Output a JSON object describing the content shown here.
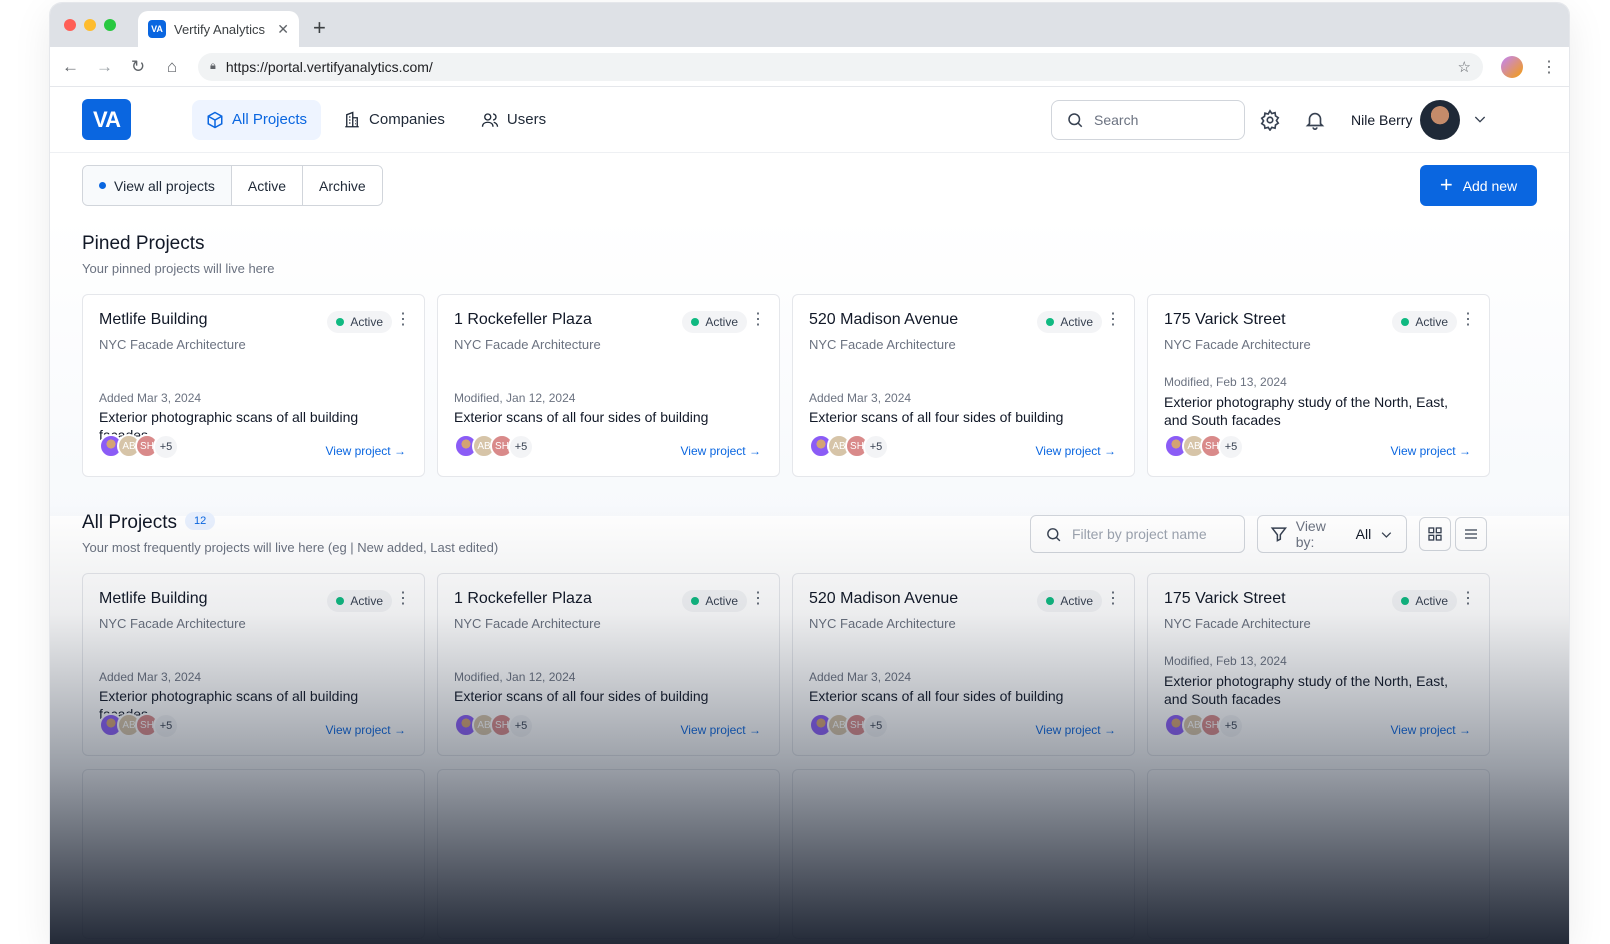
{
  "browser": {
    "tab_title": "Vertify Analytics",
    "tab_logo_text": "VA",
    "url": "https://portal.vertifyanalytics.com/"
  },
  "header": {
    "logo_text": "VA",
    "nav": [
      {
        "label": "All Projects",
        "icon": "cube-icon",
        "active": true
      },
      {
        "label": "Companies",
        "icon": "building-icon",
        "active": false
      },
      {
        "label": "Users",
        "icon": "users-icon",
        "active": false
      }
    ],
    "search_placeholder": "Search",
    "user_name": "Nile Berry"
  },
  "filters": {
    "segments": [
      "View all projects",
      "Active",
      "Archive"
    ],
    "selected": "View all projects",
    "add_button": "Add new"
  },
  "pinned": {
    "title": "Pined Projects",
    "subtitle": "Your pinned projects will live here",
    "cards": [
      {
        "title": "Metlife Building",
        "company": "NYC Facade Architecture",
        "status": "Active",
        "meta": "Added Mar 3, 2024",
        "desc": "Exterior photographic scans of all building facades",
        "avatars": [
          "",
          "AB",
          "SH"
        ],
        "more": "+5",
        "link": "View project"
      },
      {
        "title": "1 Rockefeller Plaza",
        "company": "NYC Facade Architecture",
        "status": "Active",
        "meta": "Modified, Jan 12, 2024",
        "desc": "Exterior scans of all four sides of building",
        "avatars": [
          "",
          "AB",
          "SH"
        ],
        "more": "+5",
        "link": "View project"
      },
      {
        "title": "520 Madison Avenue",
        "company": "NYC Facade Architecture",
        "status": "Active",
        "meta": "Added Mar 3, 2024",
        "desc": "Exterior scans of all four sides of building",
        "avatars": [
          "",
          "AB",
          "SH"
        ],
        "more": "+5",
        "link": "View project"
      },
      {
        "title": "175 Varick Street",
        "company": "NYC Facade Architecture",
        "status": "Active",
        "meta": "Modified, Feb 13, 2024",
        "desc": "Exterior photography study of the North, East, and South facades",
        "avatars": [
          "",
          "AB",
          "SH"
        ],
        "more": "+5",
        "link": "View project"
      }
    ]
  },
  "all": {
    "title": "All Projects",
    "count": "12",
    "subtitle": "Your most frequently projects will live here (eg | New added, Last edited)",
    "filter_placeholder": "Filter by project name",
    "view_by_label": "View by:",
    "view_by_value": "All",
    "cards": [
      {
        "title": "Metlife Building",
        "company": "NYC Facade Architecture",
        "status": "Active",
        "meta": "Added Mar 3, 2024",
        "desc": "Exterior photographic scans of all building facades",
        "avatars": [
          "",
          "AB",
          "SH"
        ],
        "more": "+5",
        "link": "View project"
      },
      {
        "title": "1 Rockefeller Plaza",
        "company": "NYC Facade Architecture",
        "status": "Active",
        "meta": "Modified, Jan 12, 2024",
        "desc": "Exterior scans of all four sides of building",
        "avatars": [
          "",
          "AB",
          "SH"
        ],
        "more": "+5",
        "link": "View project"
      },
      {
        "title": "520 Madison Avenue",
        "company": "NYC Facade Architecture",
        "status": "Active",
        "meta": "Added Mar 3, 2024",
        "desc": "Exterior scans of all four sides of building",
        "avatars": [
          "",
          "AB",
          "SH"
        ],
        "more": "+5",
        "link": "View project"
      },
      {
        "title": "175 Varick Street",
        "company": "NYC Facade Architecture",
        "status": "Active",
        "meta": "Modified, Feb 13, 2024",
        "desc": "Exterior photography study of the North, East, and South facades",
        "avatars": [
          "",
          "AB",
          "SH"
        ],
        "more": "+5",
        "link": "View project"
      }
    ]
  },
  "colors": {
    "accent": "#0a66e0",
    "status_active": "#10b981"
  }
}
